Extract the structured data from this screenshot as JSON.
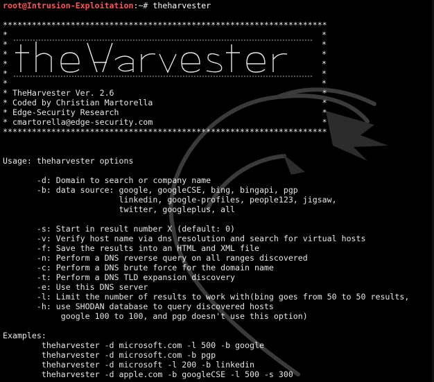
{
  "prompt": {
    "user_host": "root@Intrusion-Exploitation",
    "separator": ":~# ",
    "command": "theharvester"
  },
  "banner": {
    "border_top": "*******************************************************************",
    "star_left": "*",
    "star_right": "*",
    "logo_text": "theHarvester",
    "info_lines": [
      "* TheHarvester Ver. 2.6                                           *",
      "* Coded by Christian Martorella                                   *",
      "* Edge-Security Research                                          *",
      "* cmartorella@edge-security.com                                   *"
    ],
    "border_bottom": "*******************************************************************"
  },
  "usage": {
    "title": "Usage: theharvester options",
    "options": [
      "       -d: Domain to search or company name",
      "       -b: data source: google, googleCSE, bing, bingapi, pgp",
      "                        linkedin, google-profiles, people123, jigsaw,",
      "                        twitter, googleplus, all",
      "",
      "       -s: Start in result number X (default: 0)",
      "       -v: Verify host name via dns resolution and search for virtual hosts",
      "       -f: Save the results into an HTML and XML file",
      "       -n: Perform a DNS reverse query on all ranges discovered",
      "       -c: Perform a DNS brute force for the domain name",
      "       -t: Perform a DNS TLD expansion discovery",
      "       -e: Use this DNS server",
      "       -l: Limit the number of results to work with(bing goes from 50 to 50 results,",
      "       -h: use SHODAN database to query discovered hosts",
      "            google 100 to 100, and pgp doesn't use this option)"
    ]
  },
  "examples": {
    "title": "Examples:",
    "lines": [
      "        theharvester -d microsoft.com -l 500 -b google",
      "        theharvester -d microsoft.com -b pgp",
      "        theharvester -d microsoft -l 200 -b linkedin",
      "        theharvester -d apple.com -b googleCSE -l 500 -s 300"
    ]
  },
  "colors": {
    "background": "#000000",
    "text": "#e6e6e6",
    "prompt_user": "#ff5555",
    "prompt_path": "#5599ff",
    "dragon": "#3a3a3a"
  }
}
